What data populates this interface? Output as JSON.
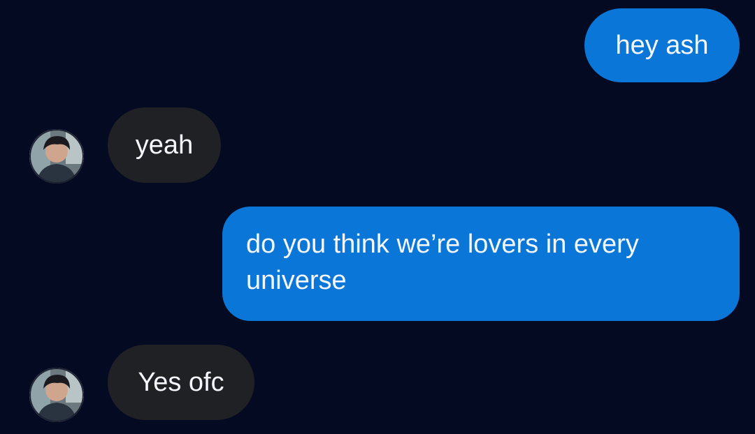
{
  "colors": {
    "background": "#030a22",
    "outgoing_bubble": "#0a76d8",
    "incoming_bubble": "#202125",
    "text": "#f5f7ff"
  },
  "messages": [
    {
      "direction": "outgoing",
      "text": "hey ash"
    },
    {
      "direction": "incoming",
      "text": "yeah",
      "avatar_icon": "user-avatar"
    },
    {
      "direction": "outgoing",
      "text": "do you think we’re lovers in every universe"
    },
    {
      "direction": "incoming",
      "text": "Yes ofc",
      "avatar_icon": "user-avatar"
    }
  ]
}
